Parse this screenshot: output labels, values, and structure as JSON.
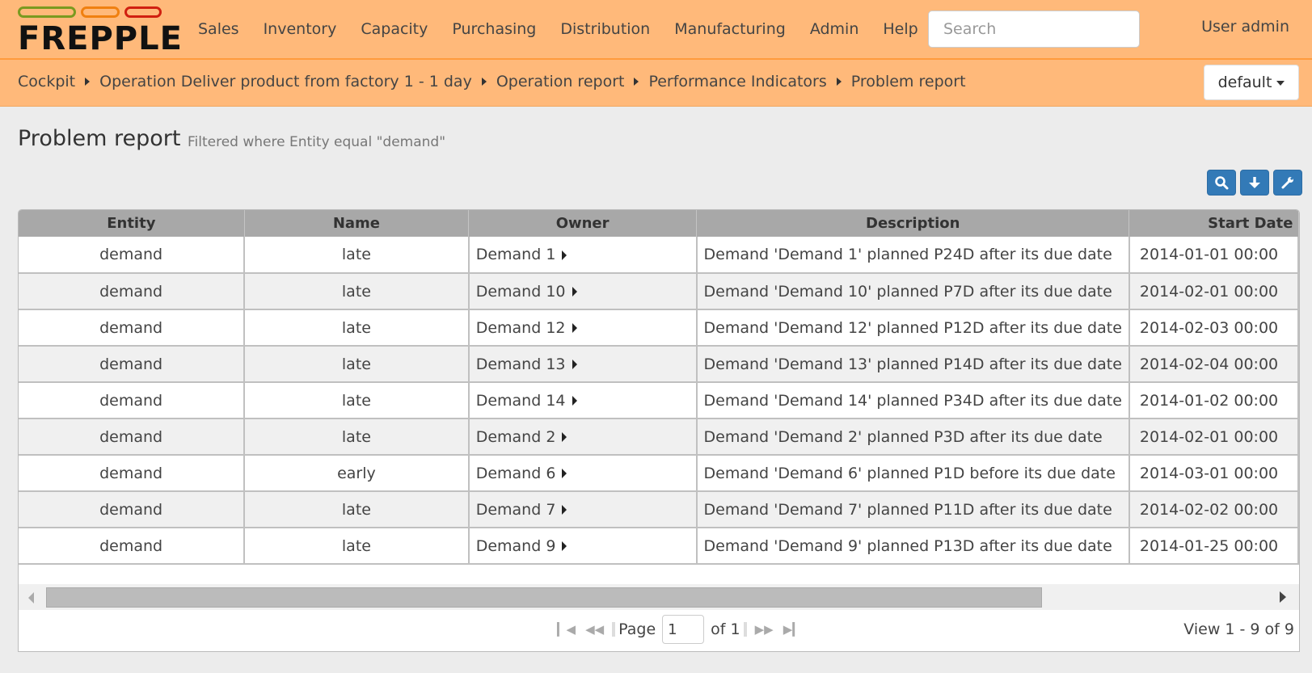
{
  "brand": {
    "name": "FREPPLE",
    "pill_colors": [
      "#7a9a20",
      "#f08010",
      "#d02010"
    ]
  },
  "nav": {
    "items": [
      {
        "label": "Sales"
      },
      {
        "label": "Inventory"
      },
      {
        "label": "Capacity"
      },
      {
        "label": "Purchasing"
      },
      {
        "label": "Distribution"
      },
      {
        "label": "Manufacturing"
      },
      {
        "label": "Admin"
      },
      {
        "label": "Help"
      }
    ],
    "search_placeholder": "Search",
    "search_value": "",
    "user_label": "User admin"
  },
  "breadcrumb": {
    "items": [
      {
        "label": "Cockpit"
      },
      {
        "label": "Operation Deliver product from factory 1 - 1 day"
      },
      {
        "label": "Operation report"
      },
      {
        "label": "Performance Indicators"
      },
      {
        "label": "Problem report"
      }
    ],
    "scenario_label": "default"
  },
  "page": {
    "title": "Problem report",
    "subtitle": "Filtered where Entity equal \"demand\""
  },
  "toolbar": {
    "buttons": [
      {
        "icon": "search-icon"
      },
      {
        "icon": "download-icon"
      },
      {
        "icon": "wrench-icon"
      }
    ],
    "accent_color": "#337ab7"
  },
  "table": {
    "columns": [
      "Entity",
      "Name",
      "Owner",
      "Description",
      "Start Date"
    ],
    "rows": [
      {
        "entity": "demand",
        "name": "late",
        "owner": "Demand 1",
        "description": "Demand 'Demand 1' planned P24D after its due date",
        "start": "2014-01-01 00:00"
      },
      {
        "entity": "demand",
        "name": "late",
        "owner": "Demand 10",
        "description": "Demand 'Demand 10' planned P7D after its due date",
        "start": "2014-02-01 00:00"
      },
      {
        "entity": "demand",
        "name": "late",
        "owner": "Demand 12",
        "description": "Demand 'Demand 12' planned P12D after its due date",
        "start": "2014-02-03 00:00"
      },
      {
        "entity": "demand",
        "name": "late",
        "owner": "Demand 13",
        "description": "Demand 'Demand 13' planned P14D after its due date",
        "start": "2014-02-04 00:00"
      },
      {
        "entity": "demand",
        "name": "late",
        "owner": "Demand 14",
        "description": "Demand 'Demand 14' planned P34D after its due date",
        "start": "2014-01-02 00:00"
      },
      {
        "entity": "demand",
        "name": "late",
        "owner": "Demand 2",
        "description": "Demand 'Demand 2' planned P3D after its due date",
        "start": "2014-02-01 00:00"
      },
      {
        "entity": "demand",
        "name": "early",
        "owner": "Demand 6",
        "description": "Demand 'Demand 6' planned P1D before its due date",
        "start": "2014-03-01 00:00"
      },
      {
        "entity": "demand",
        "name": "late",
        "owner": "Demand 7",
        "description": "Demand 'Demand 7' planned P11D after its due date",
        "start": "2014-02-02 00:00"
      },
      {
        "entity": "demand",
        "name": "late",
        "owner": "Demand 9",
        "description": "Demand 'Demand 9' planned P13D after its due date",
        "start": "2014-01-25 00:00"
      }
    ]
  },
  "pager": {
    "page_label": "Page",
    "page_value": "1",
    "of_label": "of 1",
    "view_label": "View 1 - 9 of 9"
  }
}
